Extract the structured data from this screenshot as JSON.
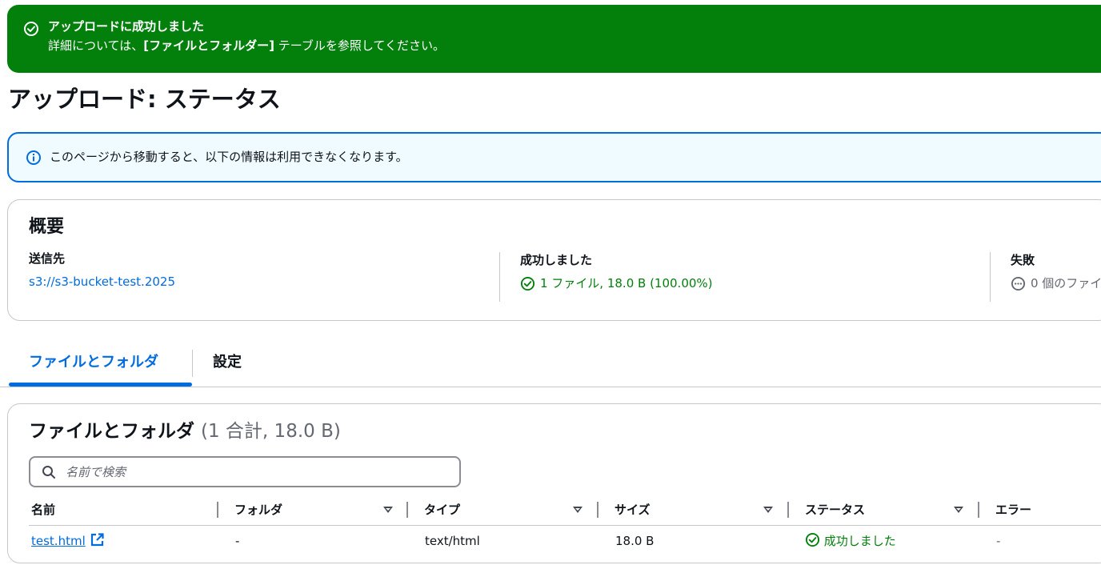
{
  "flash": {
    "title": "アップロードに成功しました",
    "message_prefix": "詳細については、",
    "message_bold": "[ファイルとフォルダー]",
    "message_suffix": " テーブルを参照してください。"
  },
  "page_title": "アップロード: ステータス",
  "info_alert": "このページから移動すると、以下の情報は利用できなくなります。",
  "summary": {
    "heading": "概要",
    "destination_label": "送信先",
    "destination_value": "s3://s3-bucket-test.2025",
    "succeeded_label": "成功しました",
    "succeeded_value": "1 ファイル, 18.0 B (100.00%)",
    "failed_label": "失敗",
    "failed_value": "0 個のファイ"
  },
  "tabs": [
    {
      "label": "ファイルとフォルダ",
      "active": true
    },
    {
      "label": "設定",
      "active": false
    }
  ],
  "files_table": {
    "heading": "ファイルとフォルダ",
    "count": "(1 合計, 18.0 B)",
    "search_placeholder": "名前で検索",
    "columns": [
      "名前",
      "フォルダ",
      "タイプ",
      "サイズ",
      "ステータス",
      "エラー"
    ],
    "rows": [
      {
        "name": "test.html",
        "folder": "-",
        "type": "text/html",
        "size": "18.0 B",
        "status": "成功しました",
        "error": "-"
      }
    ]
  },
  "colors": {
    "success_green": "#037f0c",
    "link_blue": "#006ce0",
    "info_background": "#f0fbff",
    "border_grey": "#c6c6cd"
  },
  "icons": [
    "check-circle-icon",
    "info-circle-icon",
    "more-circle-icon",
    "external-link-icon",
    "search-icon",
    "sort-caret-icon"
  ]
}
